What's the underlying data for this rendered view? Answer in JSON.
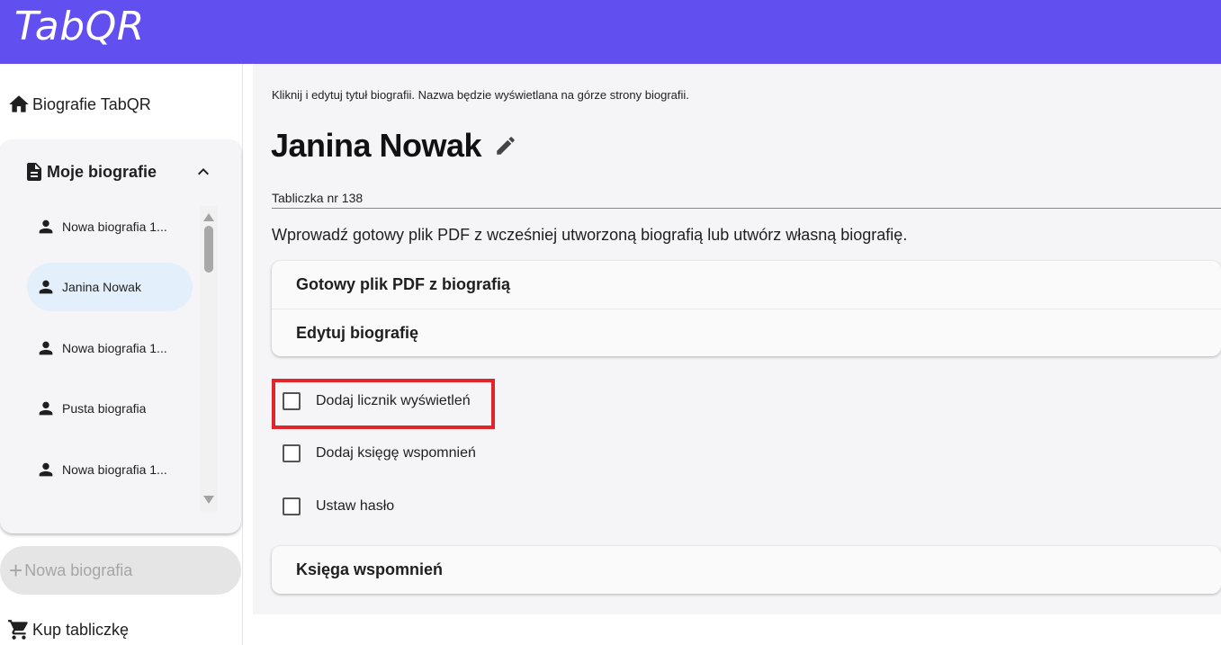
{
  "app": {
    "logo": "TabQR"
  },
  "sidebar": {
    "home_label": "Biografie TabQR",
    "my_bios": {
      "title": "Moje biografie",
      "items": [
        {
          "label": "Nowa biografia 1...",
          "active": false
        },
        {
          "label": "Janina Nowak",
          "active": true
        },
        {
          "label": "Nowa biografia 1...",
          "active": false
        },
        {
          "label": "Pusta biografia",
          "active": false
        },
        {
          "label": "Nowa biografia 1...",
          "active": false
        }
      ]
    },
    "new_bio_label": "Nowa biografia",
    "shop_label": "Kup tabliczkę"
  },
  "main": {
    "hint": "Kliknij i edytuj tytuł biografii. Nazwa będzie wyświetlana na górze strony biografii.",
    "title": "Janina Nowak",
    "plate_value": "Tabliczka nr 138",
    "intro": "Wprowadź gotowy plik PDF z wcześniej utworzoną biografią lub utwórz własną biografię.",
    "accordion_top": [
      "Gotowy plik PDF z biografią",
      "Edytuj biografię"
    ],
    "options": [
      {
        "label": "Dodaj licznik wyświetleń",
        "checked": false
      },
      {
        "label": "Dodaj księgę wspomnień",
        "checked": false
      },
      {
        "label": "Ustaw hasło",
        "checked": false
      }
    ],
    "accordion_bottom": [
      "Księga wspomnień"
    ]
  },
  "colors": {
    "header": "#624ff0",
    "active_item": "#e3f0fb",
    "highlight": "#e0262b",
    "panel": "#f5f5f7"
  }
}
